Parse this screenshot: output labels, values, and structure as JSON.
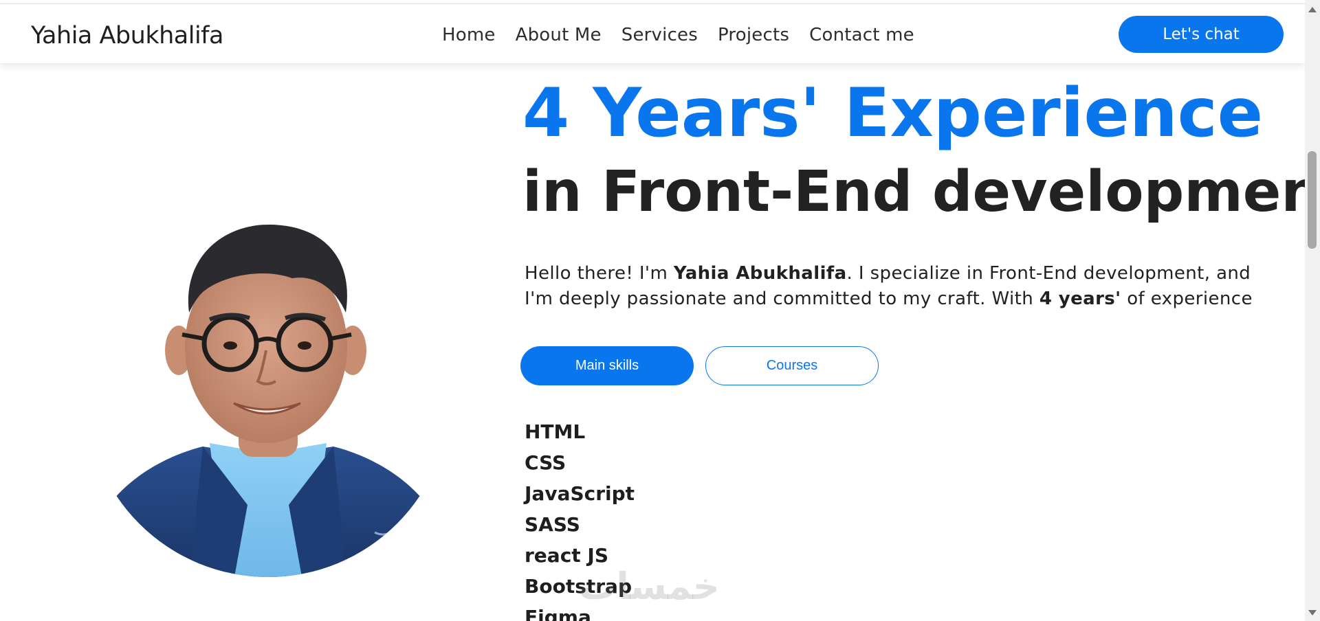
{
  "navbar": {
    "brand": "Yahia Abukhalifa",
    "links": [
      "Home",
      "About Me",
      "Services",
      "Projects",
      "Contact me"
    ],
    "cta_label": "Let's chat"
  },
  "hero": {
    "headline_accent": "4 Years' Experience",
    "headline_rest": "in Front-End development",
    "intro": {
      "part1": "Hello there! I'm ",
      "name": "Yahia Abukhalifa",
      "part2": ". I specialize in Front-End development, and I'm deeply passionate and committed to my craft. With ",
      "years": "4 years'",
      "part3": " of experience"
    },
    "buttons": {
      "main_skills": "Main skills",
      "courses": "Courses"
    },
    "skills": [
      "HTML",
      "CSS",
      "JavaScript",
      "SASS",
      "react JS",
      "Bootstrap",
      "Figma"
    ]
  },
  "watermark": "خمسات",
  "colors": {
    "accent": "#0a76ee",
    "text_dark": "#222222",
    "background": "#ffffff"
  },
  "icons": {
    "scroll_up": "triangle-up-icon",
    "scroll_down": "triangle-down-icon"
  }
}
